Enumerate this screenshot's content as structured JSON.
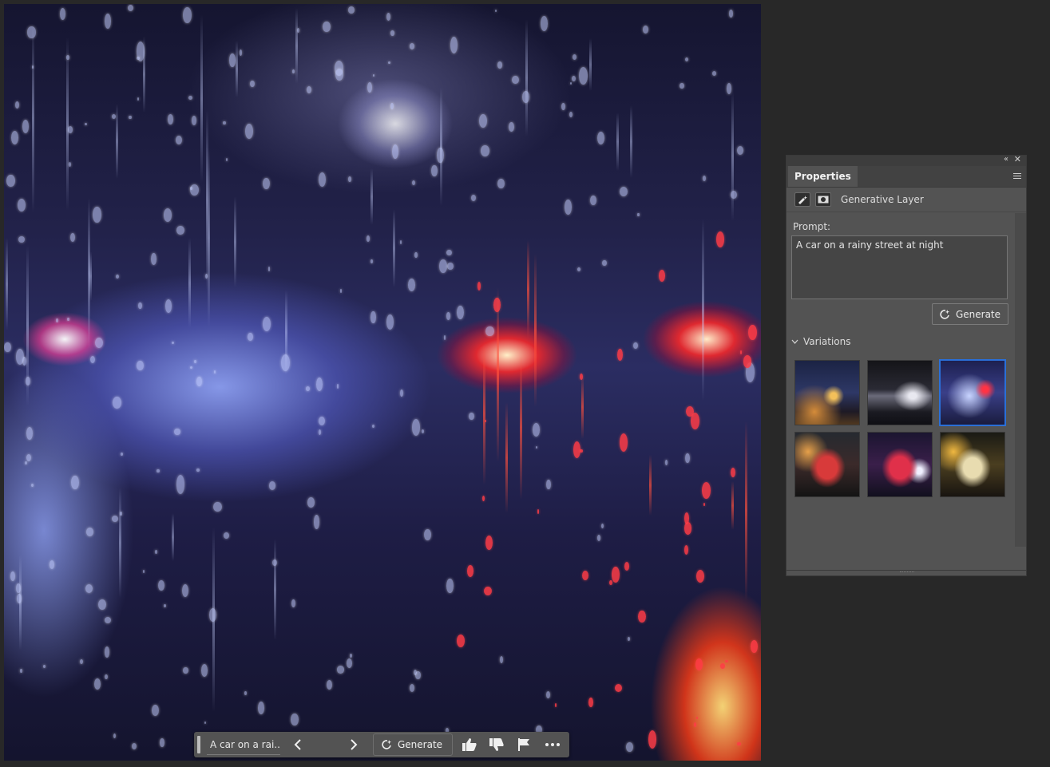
{
  "canvas": {
    "image_description_icon": "rainy-window-night-image"
  },
  "taskbar": {
    "prompt_text": "A car on a rai...",
    "generate_label": "Generate",
    "icons": [
      "previous-icon",
      "next-icon",
      "generate-icon",
      "thumbs-up-icon",
      "thumbs-down-icon",
      "flag-icon",
      "more-icon"
    ]
  },
  "panel": {
    "tab_label": "Properties",
    "layer_type_label": "Generative Layer",
    "prompt_label": "Prompt:",
    "prompt_value": "A car on a rainy street at night",
    "generate_label": "Generate",
    "variations_label": "Variations",
    "variations": [
      {
        "name": "variation-1",
        "selected": false
      },
      {
        "name": "variation-2",
        "selected": false
      },
      {
        "name": "variation-3",
        "selected": true
      },
      {
        "name": "variation-4",
        "selected": false
      },
      {
        "name": "variation-5",
        "selected": false
      },
      {
        "name": "variation-6",
        "selected": false
      }
    ]
  },
  "colors": {
    "selection": "#2a6fd8",
    "panel_bg": "#535353",
    "app_bg": "#282828"
  }
}
